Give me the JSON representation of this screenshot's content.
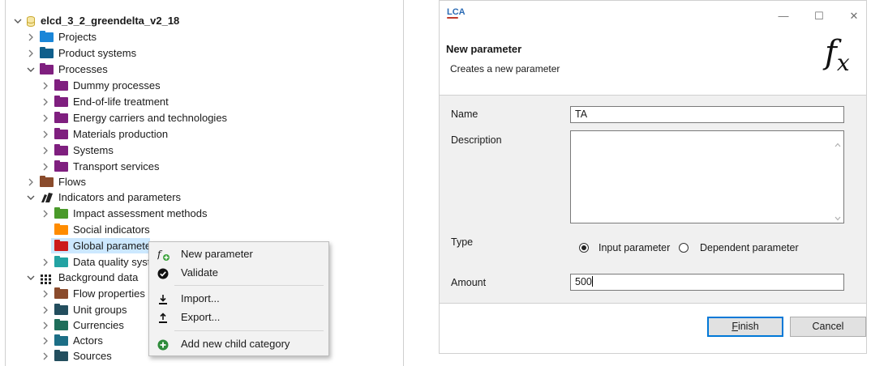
{
  "navigator": {
    "root": "elcd_3_2_greendelta_v2_18",
    "items": [
      {
        "label": "Projects",
        "color": "#1a86d8"
      },
      {
        "label": "Product systems",
        "color": "#0f5f8c"
      },
      {
        "label": "Processes",
        "color": "#7f1f7f"
      },
      {
        "label": "Dummy processes",
        "color": "#7f1f7f"
      },
      {
        "label": "End-of-life treatment",
        "color": "#7f1f7f"
      },
      {
        "label": "Energy carriers and technologies",
        "color": "#7f1f7f"
      },
      {
        "label": "Materials production",
        "color": "#7f1f7f"
      },
      {
        "label": "Systems",
        "color": "#7f1f7f"
      },
      {
        "label": "Transport services",
        "color": "#7f1f7f"
      },
      {
        "label": "Flows",
        "color": "#8a4b2c"
      },
      {
        "label": "Indicators and parameters"
      },
      {
        "label": "Impact assessment methods",
        "color": "#4a9a2a"
      },
      {
        "label": "Social indicators",
        "color": "#ff8c00"
      },
      {
        "label": "Global parameters",
        "color": "#cc1b1b"
      },
      {
        "label": "Data quality systems",
        "color": "#23a3a3"
      },
      {
        "label": "Background data"
      },
      {
        "label": "Flow properties",
        "color": "#8a4b2c"
      },
      {
        "label": "Unit groups",
        "color": "#234e5e"
      },
      {
        "label": "Currencies",
        "color": "#1e6e5a"
      },
      {
        "label": "Actors",
        "color": "#1c6e86"
      },
      {
        "label": "Sources",
        "color": "#234e5e"
      }
    ]
  },
  "context_menu": {
    "items": [
      {
        "label": "New parameter",
        "icon": "function-plus-icon"
      },
      {
        "label": "Validate",
        "icon": "check-circle-icon"
      },
      {
        "label": "Import...",
        "icon": "import-icon"
      },
      {
        "label": "Export...",
        "icon": "export-icon"
      },
      {
        "label": "Add new child category",
        "icon": "add-circle-icon"
      }
    ]
  },
  "dialog": {
    "logo": "LCA",
    "title": "New parameter",
    "subtitle": "Creates a new parameter",
    "fx_symbol": "f",
    "fx_sub": "x",
    "labels": {
      "name": "Name",
      "description": "Description",
      "type": "Type",
      "amount": "Amount"
    },
    "values": {
      "name": "TA",
      "description": "",
      "amount": "500"
    },
    "type_options": [
      "Input parameter",
      "Dependent parameter"
    ],
    "type_selected": "Input parameter",
    "buttons": {
      "finish_prefix": "",
      "finish_mnemonic": "F",
      "finish_rest": "inish",
      "cancel": "Cancel"
    },
    "window_controls": {
      "minimize": "—",
      "maximize": "☐",
      "close": "✕"
    }
  }
}
